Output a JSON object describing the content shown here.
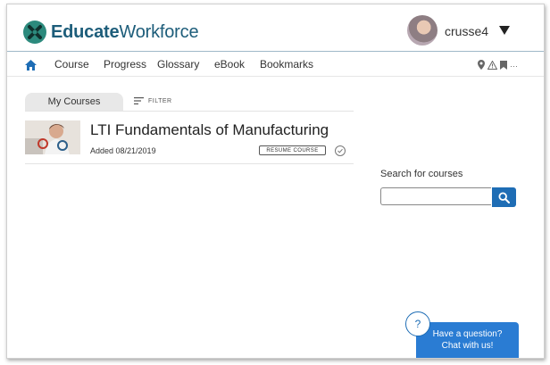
{
  "brand": {
    "name_bold": "Educate",
    "name_regular": "Workforce",
    "color": "#1d5d7a",
    "mark_color": "#2c8a7d"
  },
  "user": {
    "username": "crusse4"
  },
  "nav": {
    "home_icon": "home-icon",
    "items": [
      "Course",
      "Progress",
      "Glossary",
      "eBook",
      "Bookmarks"
    ],
    "right_icons": [
      "map-pin-icon",
      "warning-icon",
      "bookmark-icon",
      "more-icon"
    ],
    "more_glyph": "···"
  },
  "tabs": {
    "active": "My Courses",
    "filter_label": "FILTER"
  },
  "courses": [
    {
      "title": "LTI Fundamentals of Manufacturing",
      "added": "Added 08/21/2019",
      "resume_label": "RESUME COURSE"
    }
  ],
  "search": {
    "label": "Search for courses",
    "value": "",
    "placeholder": ""
  },
  "chat": {
    "help_glyph": "?",
    "line1": "Have a question?",
    "line2": "Chat with us!"
  },
  "colors": {
    "accent": "#1e6db5",
    "chat": "#2a7cd3"
  }
}
